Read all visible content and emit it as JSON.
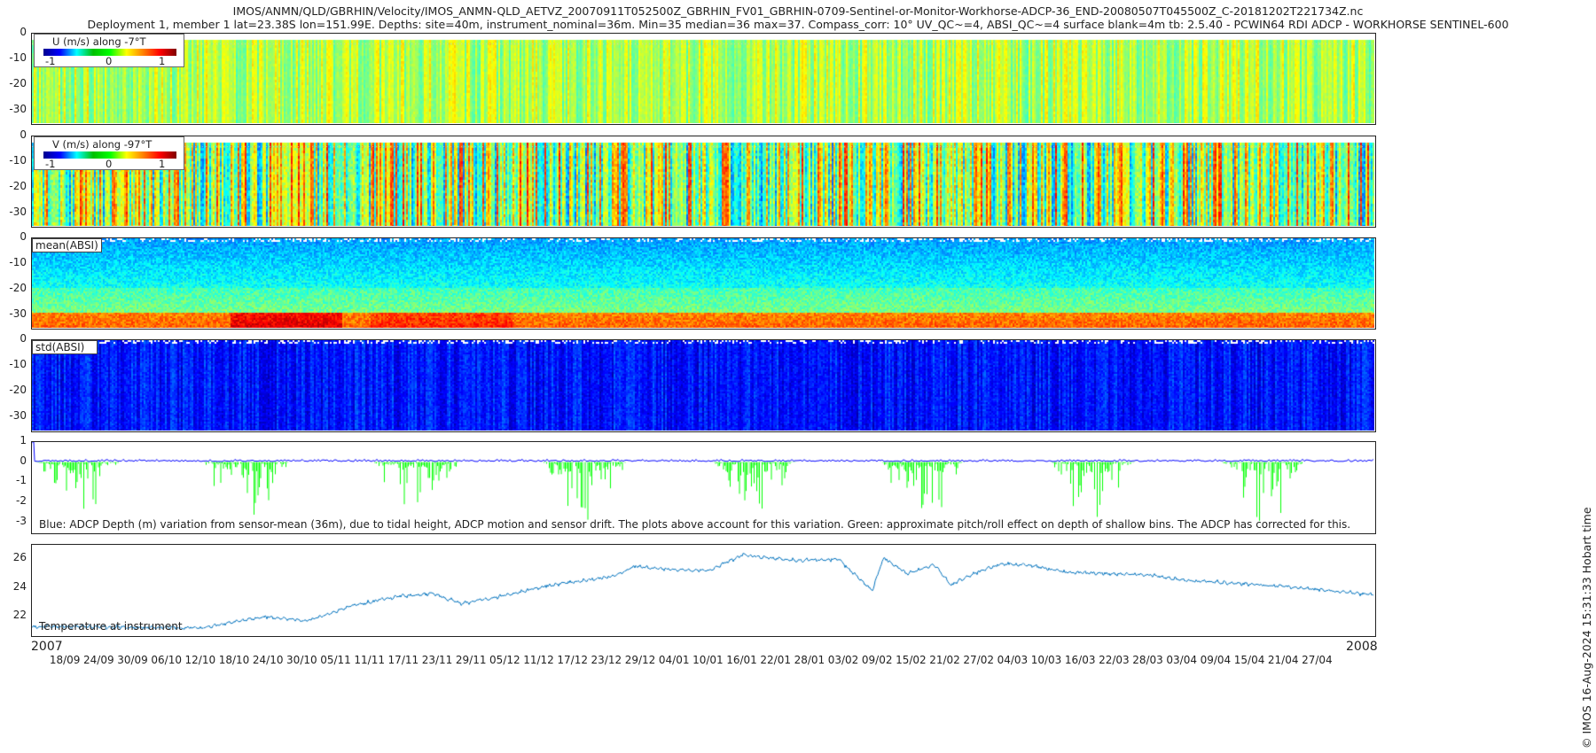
{
  "title": {
    "line1": "IMOS/ANMN/QLD/GBRHIN/Velocity/IMOS_ANMN-QLD_AETVZ_20070911T052500Z_GBRHIN_FV01_GBRHIN-0709-Sentinel-or-Monitor-Workhorse-ADCP-36_END-20080507T045500Z_C-20181202T221734Z.nc",
    "line2": "Deployment 1, member 1 lat=23.38S lon=151.99E. Depths: site=40m, instrument_nominal=36m. Min=35 median=36 max=37. Compass_corr: 10° UV_QC~=4, ABSI_QC~=4 surface blank=4m tb: 2.5.40 - PCWIN64 RDI ADCP - WORKHORSE SENTINEL-600"
  },
  "credit": "© IMOS 16-Aug-2024 15:31:33 Hobart time",
  "chart_data": [
    {
      "type": "heatmap",
      "name": "U",
      "colorbar_label": "U (m/s) along -7°T",
      "colorbar_ticks": [
        "-1",
        "0",
        "1"
      ],
      "clim": [
        -1.2,
        1.2
      ],
      "ylim": [
        -35,
        0
      ],
      "yticks": [
        "0",
        "-10",
        "-20",
        "-30"
      ],
      "colormap": "jet"
    },
    {
      "type": "heatmap",
      "name": "V",
      "colorbar_label": "V (m/s) along -97°T",
      "colorbar_ticks": [
        "-1",
        "0",
        "1"
      ],
      "clim": [
        -1.2,
        1.2
      ],
      "ylim": [
        -35,
        0
      ],
      "yticks": [
        "0",
        "-10",
        "-20",
        "-30"
      ],
      "colormap": "jet"
    },
    {
      "type": "heatmap",
      "name": "mean(ABSI)",
      "label": "mean(ABSI)",
      "ylim": [
        -35,
        0
      ],
      "yticks": [
        "0",
        "-10",
        "-20",
        "-30"
      ],
      "colormap": "jet"
    },
    {
      "type": "heatmap",
      "name": "std(ABSI)",
      "label": "std(ABSI)",
      "ylim": [
        -35,
        0
      ],
      "yticks": [
        "0",
        "-10",
        "-20",
        "-30"
      ],
      "colormap": "jet"
    },
    {
      "type": "line",
      "name": "depth",
      "ylim": [
        -3.5,
        1
      ],
      "yticks": [
        "1",
        "0",
        "-1",
        "-2",
        "-3"
      ],
      "annotation": "Blue: ADCP Depth (m) variation from sensor-mean (36m), due to tidal height, ADCP motion and sensor drift. The plots above account for this variation. Green: approximate pitch/roll effect on depth of shallow bins. The ADCP has corrected for this.",
      "series": [
        {
          "name": "ADCP depth variation",
          "color": "#0000ff",
          "typical": 0.1,
          "start_spike": 1
        },
        {
          "name": "pitch/roll effect",
          "color": "#00ff00",
          "min": -3.5
        }
      ]
    },
    {
      "type": "line",
      "name": "temperature",
      "label": "Temperature at instrument",
      "ylim": [
        20.7,
        27
      ],
      "yticks": [
        "22",
        "24",
        "26"
      ],
      "color": "#0072bd",
      "x_days_since_2007_09_12": [
        0,
        6,
        30,
        41,
        49,
        57,
        65,
        71,
        76,
        82,
        92,
        103,
        107,
        113,
        120,
        126,
        135,
        143,
        151,
        149,
        155,
        160,
        163,
        167,
        172,
        178,
        183,
        198,
        205,
        214,
        222,
        230,
        238
      ],
      "y": [
        21.3,
        21.3,
        21.2,
        22.0,
        21.7,
        22.8,
        23.4,
        23.6,
        22.9,
        23.3,
        24.2,
        24.8,
        25.5,
        25.3,
        25.2,
        26.3,
        25.9,
        26.0,
        26.1,
        23.8,
        25.0,
        25.6,
        24.2,
        25.0,
        25.7,
        25.5,
        25.1,
        24.9,
        24.5,
        24.3,
        24.1,
        23.8,
        23.5
      ]
    }
  ],
  "xaxis": {
    "year_start": "2007",
    "year_end": "2008",
    "ticks": [
      "18/09",
      "24/09",
      "30/09",
      "06/10",
      "12/10",
      "18/10",
      "24/10",
      "30/10",
      "05/11",
      "11/11",
      "17/11",
      "23/11",
      "29/11",
      "05/12",
      "11/12",
      "17/12",
      "23/12",
      "29/12",
      "04/01",
      "10/01",
      "16/01",
      "22/01",
      "28/01",
      "03/02",
      "09/02",
      "15/02",
      "21/02",
      "27/02",
      "04/03",
      "10/03",
      "16/03",
      "22/03",
      "28/03",
      "03/04",
      "09/04",
      "15/04",
      "21/04",
      "27/04"
    ]
  }
}
